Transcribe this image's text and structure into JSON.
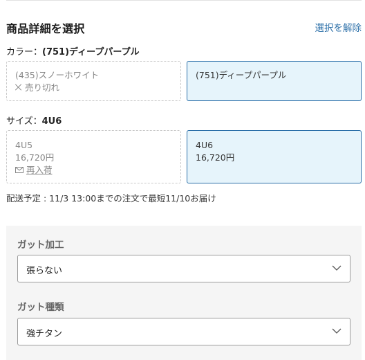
{
  "header": {
    "title": "商品詳細を選択",
    "clear_link": "選択を解除"
  },
  "color": {
    "label": "カラー：",
    "selected": "(751)ディープパープル",
    "options": [
      {
        "name": "(435)スノーホワイト",
        "status": "売り切れ",
        "state": "unavailable"
      },
      {
        "name": "(751)ディープパープル",
        "state": "selected"
      }
    ]
  },
  "size": {
    "label": "サイズ：",
    "selected": "4U6",
    "options": [
      {
        "name": "4U5",
        "price": "16,720円",
        "action": "再入荷",
        "state": "unavailable"
      },
      {
        "name": "4U6",
        "price": "16,720円",
        "state": "selected"
      }
    ]
  },
  "delivery": {
    "text": "配送予定 : 11/3 13:00までの注文で最短11/10お届け"
  },
  "options_panel": {
    "gut_processing": {
      "label": "ガット加工",
      "value": "張らない"
    },
    "gut_type": {
      "label": "ガット種類",
      "value": "強チタン"
    }
  },
  "colors": {
    "accent": "#2b6fa8",
    "selected_bg": "#e6f4fb",
    "panel_bg": "#f5f5f5"
  },
  "icons": {
    "soldout": "x-mark-icon",
    "restock": "mail-icon",
    "select": "chevron-down-icon"
  }
}
